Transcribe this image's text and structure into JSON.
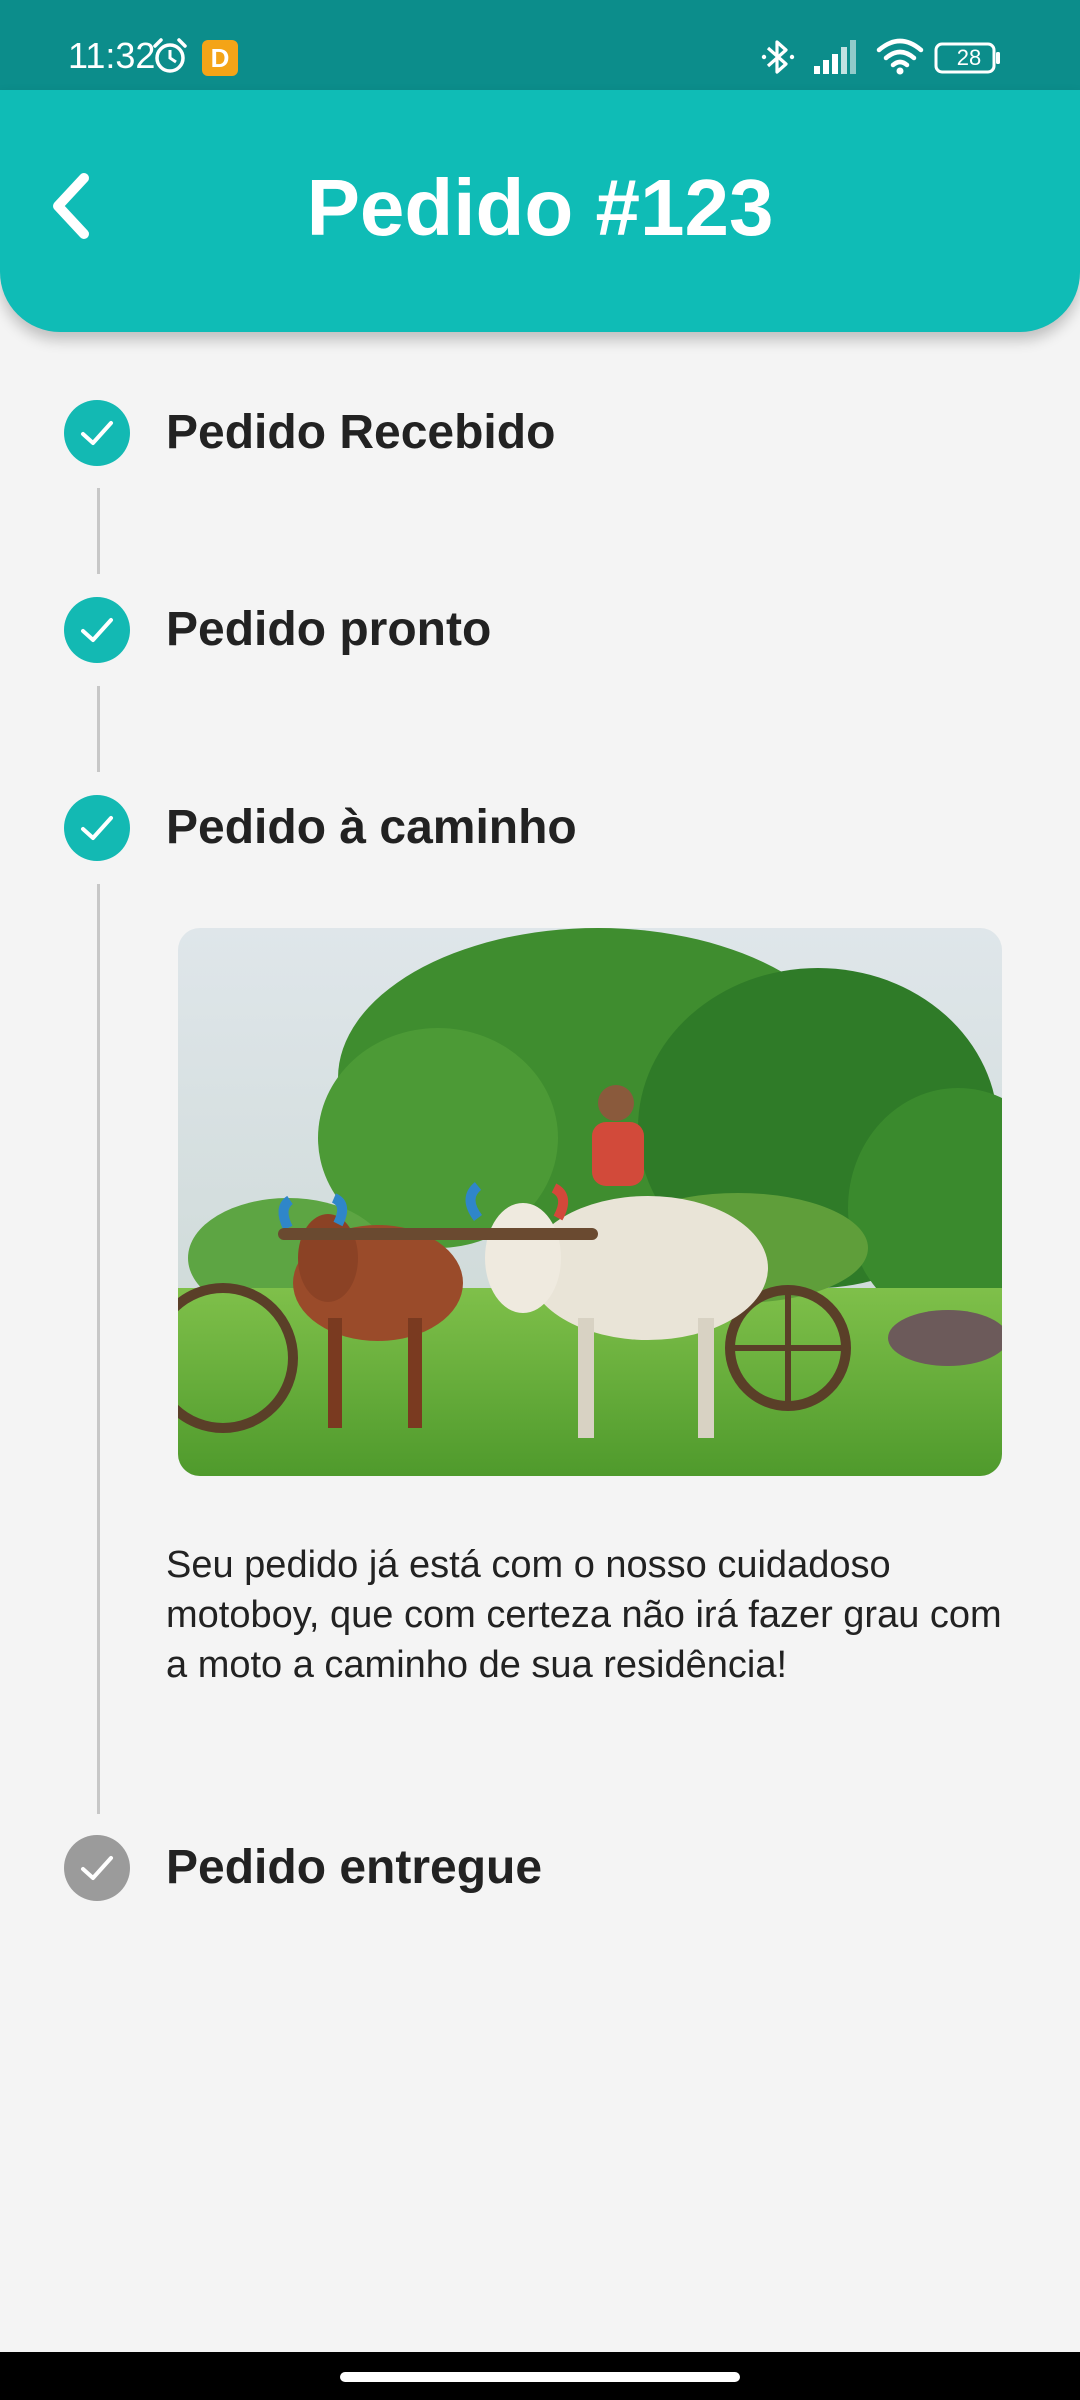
{
  "status_bar": {
    "time": "11:32",
    "app_icon_letter": "D",
    "battery": "28",
    "icons": [
      "alarm-icon",
      "app-notification-icon",
      "bluetooth-icon",
      "signal-icon",
      "wifi-icon",
      "battery-icon"
    ]
  },
  "header": {
    "title": "Pedido #123",
    "back_icon": "chevron-left-icon",
    "color": "#0fbcb6"
  },
  "timeline": {
    "steps": [
      {
        "label": "Pedido Recebido",
        "status": "done"
      },
      {
        "label": "Pedido pronto",
        "status": "done"
      },
      {
        "label": "Pedido à caminho",
        "status": "done"
      },
      {
        "label": "Pedido entregue",
        "status": "pending"
      }
    ],
    "active_color": "#13b9b3",
    "pending_color": "#9b9b9b",
    "detail": {
      "image_alt": "Carro de boi com homem conduzindo",
      "description": "Seu pedido já está com o nosso cuidadoso motoboy, que com certeza não irá fazer grau com a moto a caminho de sua residência!"
    }
  }
}
